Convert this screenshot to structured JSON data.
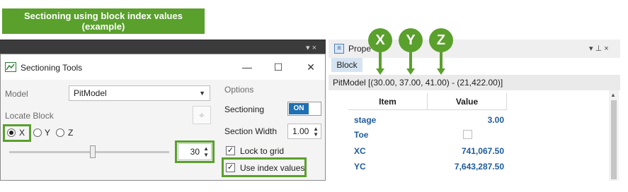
{
  "banner": {
    "line1": "Sectioning using block index values",
    "line2": "(example)"
  },
  "left_dock": {
    "controls": "▾ ×"
  },
  "dialog": {
    "title": "Sectioning Tools",
    "app_icon": "pit-icon",
    "minimize": "—",
    "maximize": "☐",
    "close": "✕",
    "model_label": "Model",
    "model_value": "PitModel",
    "locate_block_label": "Locate Block",
    "locate_icon": "crosshair-icon",
    "axis_options": [
      "X",
      "Y",
      "Z"
    ],
    "axis_selected": "X",
    "spin_value": "30",
    "options_label": "Options",
    "sectioning_label": "Sectioning",
    "toggle_on_label": "ON",
    "section_width_label": "Section Width",
    "section_width_value": "1.00",
    "lock_to_grid_label": "Lock to grid",
    "lock_to_grid_checked": true,
    "use_index_label": "Use index values",
    "use_index_checked": true
  },
  "properties": {
    "title": "Prope",
    "controls": "▾ ⊥ ×",
    "tab": "Block",
    "path": "PitModel  [(30.00, 37.00, 41.00) - (21,422.00)]",
    "columns": [
      "Item",
      "Value"
    ],
    "rows": [
      {
        "item": "stage",
        "value": "3.00"
      },
      {
        "item": "Toe",
        "value": ""
      },
      {
        "item": "XC",
        "value": "741,067.50"
      },
      {
        "item": "YC",
        "value": "7,643,287.50"
      }
    ]
  },
  "badges": [
    "X",
    "Y",
    "Z"
  ],
  "colors": {
    "accent_green": "#5aa02c",
    "toggle_blue": "#1f6fb4",
    "link_blue": "#1f5b9c"
  }
}
